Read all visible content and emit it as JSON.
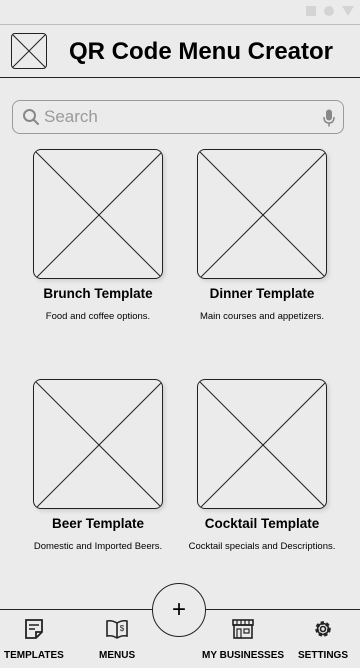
{
  "header": {
    "title": "QR Code Menu Creator"
  },
  "search": {
    "placeholder": "Search",
    "value": ""
  },
  "templates": [
    {
      "name": "Brunch Template",
      "description": "Food and coffee options."
    },
    {
      "name": "Dinner Template",
      "description": "Main courses and appetizers."
    },
    {
      "name": "Beer Template",
      "description": "Domestic and Imported Beers."
    },
    {
      "name": "Cocktail Template",
      "description": "Cocktail specials and Descriptions."
    }
  ],
  "fab": {
    "label": "+"
  },
  "nav": {
    "items": [
      {
        "label": "TEMPLATES",
        "icon": "templates-icon"
      },
      {
        "label": "MENUS",
        "icon": "menu-book-icon"
      },
      {
        "label": "MY BUSINESSES",
        "icon": "storefront-icon"
      },
      {
        "label": "SETTINGS",
        "icon": "gear-icon"
      }
    ]
  }
}
